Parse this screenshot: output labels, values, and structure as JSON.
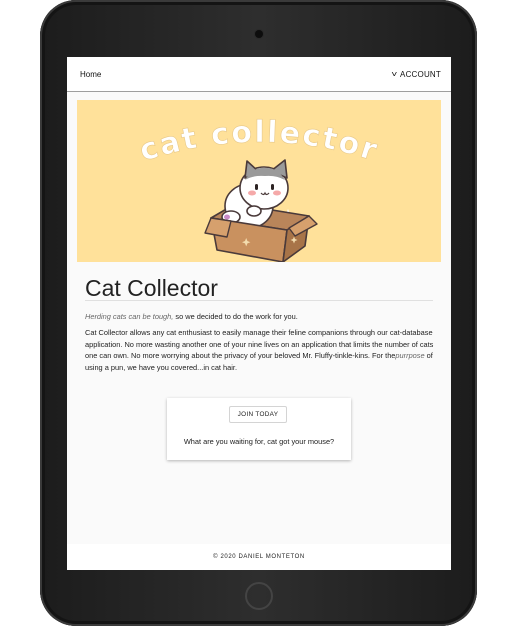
{
  "nav": {
    "home_label": "Home",
    "account_label": "ACCOUNT"
  },
  "hero": {
    "banner_text": "cat collector",
    "background_color": "#ffe19a"
  },
  "main": {
    "title": "Cat Collector",
    "intro_italic": "Herding cats can be tough,",
    "intro_rest": " so we decided to do the work for you.",
    "body_before": "Cat Collector allows any cat enthusiast to easily manage their feline companions through our cat-database application. No more wasting another one of your nine lives on an application that limits the number of cats one can own. No more worrying about the privacy of your beloved Mr. Fluffy-tinkle-kins. For the",
    "body_italic": "purrpose",
    "body_after": " of using a pun, we have you covered...in cat hair."
  },
  "cta": {
    "button_label": "JOIN TODAY",
    "tagline": "What are you waiting for, cat got your mouse?"
  },
  "footer": {
    "text": "© 2020 DANIEL MONTETON"
  },
  "icons": {
    "account": "chevron-down-icon"
  }
}
